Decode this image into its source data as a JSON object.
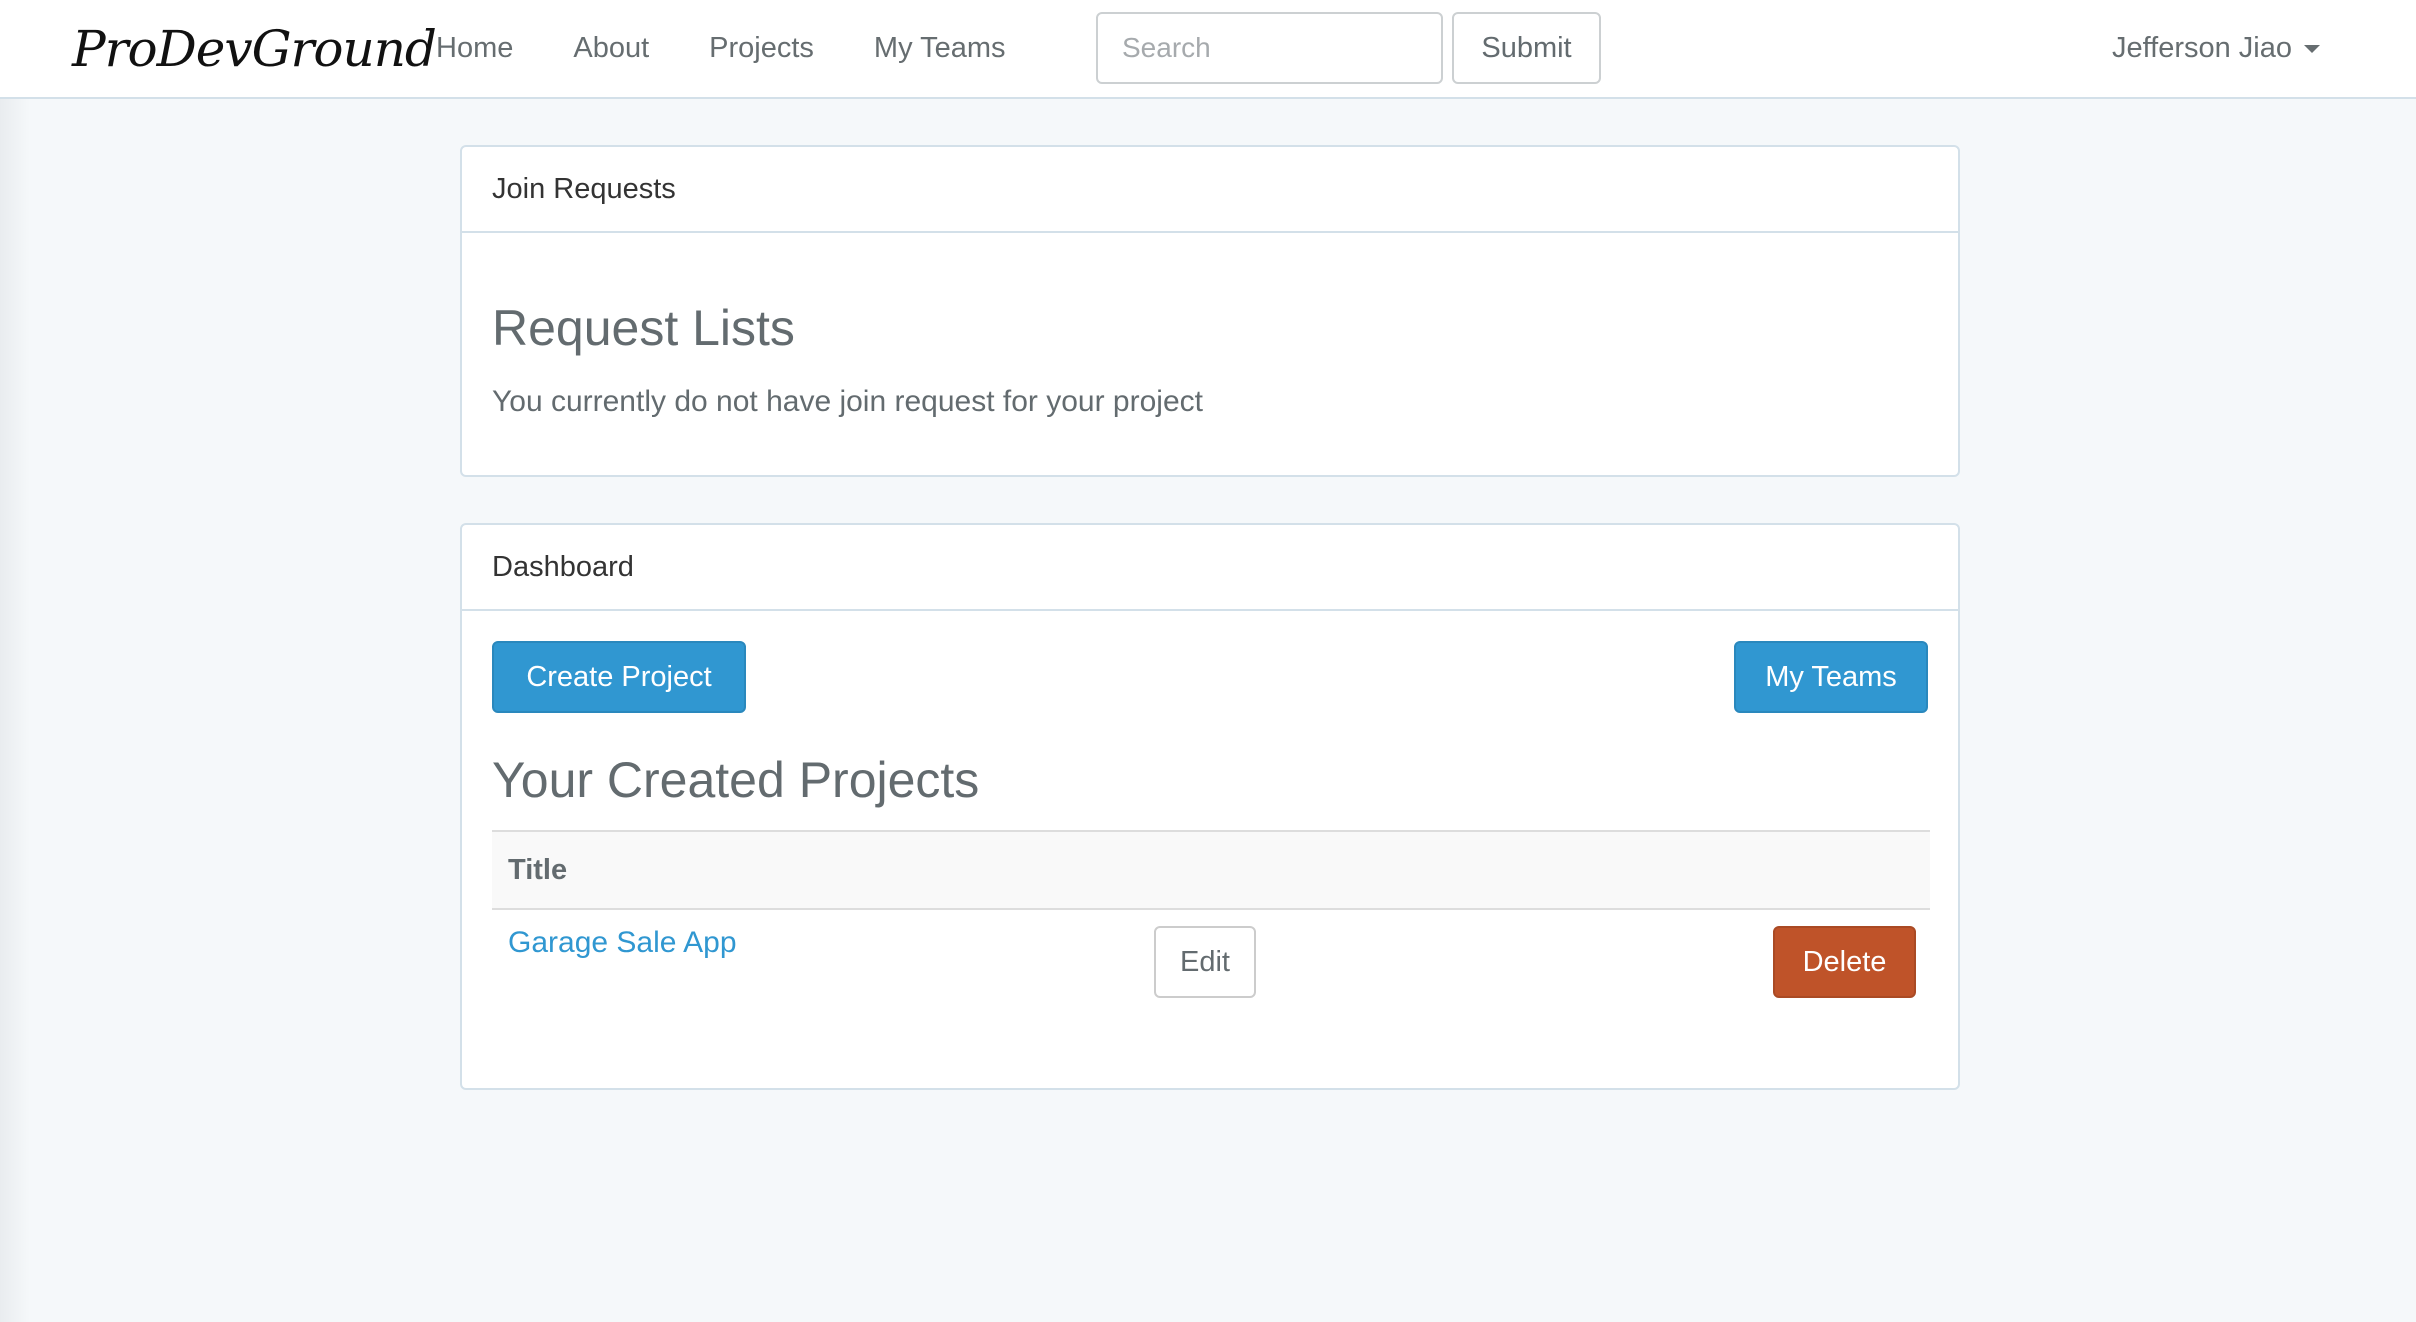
{
  "navbar": {
    "brand": "ProDevGround",
    "links": [
      {
        "label": "Home"
      },
      {
        "label": "About"
      },
      {
        "label": "Projects"
      },
      {
        "label": "My Teams"
      }
    ],
    "search": {
      "placeholder": "Search",
      "value": ""
    },
    "submit_label": "Submit",
    "user_name": "Jefferson Jiao"
  },
  "join_requests": {
    "heading": "Join Requests",
    "title": "Request Lists",
    "message": "You currently do not have join request for your project"
  },
  "dashboard": {
    "heading": "Dashboard",
    "create_button": "Create Project",
    "teams_button": "My Teams",
    "title": "Your Created Projects",
    "table": {
      "column_title": "Title",
      "rows": [
        {
          "title": "Garage Sale App",
          "edit_label": "Edit",
          "delete_label": "Delete"
        }
      ]
    }
  },
  "colors": {
    "primary": "#3097d1",
    "danger": "#bf5329",
    "background": "#f5f8fa",
    "border": "#d3e0e9"
  }
}
